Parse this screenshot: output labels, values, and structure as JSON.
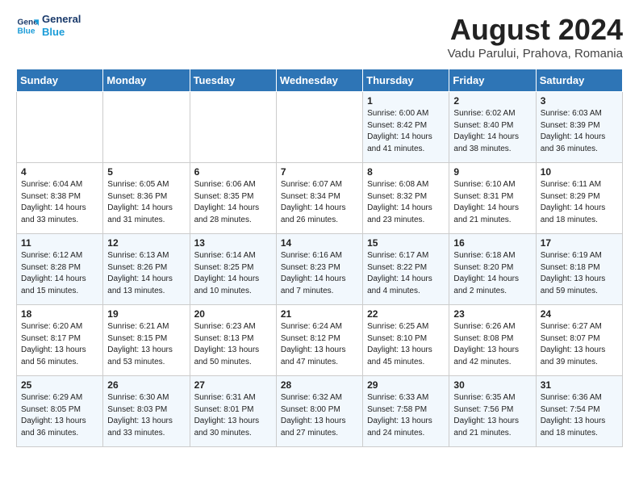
{
  "header": {
    "logo_line1": "General",
    "logo_line2": "Blue",
    "main_title": "August 2024",
    "subtitle": "Vadu Parului, Prahova, Romania"
  },
  "weekdays": [
    "Sunday",
    "Monday",
    "Tuesday",
    "Wednesday",
    "Thursday",
    "Friday",
    "Saturday"
  ],
  "weeks": [
    [
      {
        "day": "",
        "info": ""
      },
      {
        "day": "",
        "info": ""
      },
      {
        "day": "",
        "info": ""
      },
      {
        "day": "",
        "info": ""
      },
      {
        "day": "1",
        "info": "Sunrise: 6:00 AM\nSunset: 8:42 PM\nDaylight: 14 hours\nand 41 minutes."
      },
      {
        "day": "2",
        "info": "Sunrise: 6:02 AM\nSunset: 8:40 PM\nDaylight: 14 hours\nand 38 minutes."
      },
      {
        "day": "3",
        "info": "Sunrise: 6:03 AM\nSunset: 8:39 PM\nDaylight: 14 hours\nand 36 minutes."
      }
    ],
    [
      {
        "day": "4",
        "info": "Sunrise: 6:04 AM\nSunset: 8:38 PM\nDaylight: 14 hours\nand 33 minutes."
      },
      {
        "day": "5",
        "info": "Sunrise: 6:05 AM\nSunset: 8:36 PM\nDaylight: 14 hours\nand 31 minutes."
      },
      {
        "day": "6",
        "info": "Sunrise: 6:06 AM\nSunset: 8:35 PM\nDaylight: 14 hours\nand 28 minutes."
      },
      {
        "day": "7",
        "info": "Sunrise: 6:07 AM\nSunset: 8:34 PM\nDaylight: 14 hours\nand 26 minutes."
      },
      {
        "day": "8",
        "info": "Sunrise: 6:08 AM\nSunset: 8:32 PM\nDaylight: 14 hours\nand 23 minutes."
      },
      {
        "day": "9",
        "info": "Sunrise: 6:10 AM\nSunset: 8:31 PM\nDaylight: 14 hours\nand 21 minutes."
      },
      {
        "day": "10",
        "info": "Sunrise: 6:11 AM\nSunset: 8:29 PM\nDaylight: 14 hours\nand 18 minutes."
      }
    ],
    [
      {
        "day": "11",
        "info": "Sunrise: 6:12 AM\nSunset: 8:28 PM\nDaylight: 14 hours\nand 15 minutes."
      },
      {
        "day": "12",
        "info": "Sunrise: 6:13 AM\nSunset: 8:26 PM\nDaylight: 14 hours\nand 13 minutes."
      },
      {
        "day": "13",
        "info": "Sunrise: 6:14 AM\nSunset: 8:25 PM\nDaylight: 14 hours\nand 10 minutes."
      },
      {
        "day": "14",
        "info": "Sunrise: 6:16 AM\nSunset: 8:23 PM\nDaylight: 14 hours\nand 7 minutes."
      },
      {
        "day": "15",
        "info": "Sunrise: 6:17 AM\nSunset: 8:22 PM\nDaylight: 14 hours\nand 4 minutes."
      },
      {
        "day": "16",
        "info": "Sunrise: 6:18 AM\nSunset: 8:20 PM\nDaylight: 14 hours\nand 2 minutes."
      },
      {
        "day": "17",
        "info": "Sunrise: 6:19 AM\nSunset: 8:18 PM\nDaylight: 13 hours\nand 59 minutes."
      }
    ],
    [
      {
        "day": "18",
        "info": "Sunrise: 6:20 AM\nSunset: 8:17 PM\nDaylight: 13 hours\nand 56 minutes."
      },
      {
        "day": "19",
        "info": "Sunrise: 6:21 AM\nSunset: 8:15 PM\nDaylight: 13 hours\nand 53 minutes."
      },
      {
        "day": "20",
        "info": "Sunrise: 6:23 AM\nSunset: 8:13 PM\nDaylight: 13 hours\nand 50 minutes."
      },
      {
        "day": "21",
        "info": "Sunrise: 6:24 AM\nSunset: 8:12 PM\nDaylight: 13 hours\nand 47 minutes."
      },
      {
        "day": "22",
        "info": "Sunrise: 6:25 AM\nSunset: 8:10 PM\nDaylight: 13 hours\nand 45 minutes."
      },
      {
        "day": "23",
        "info": "Sunrise: 6:26 AM\nSunset: 8:08 PM\nDaylight: 13 hours\nand 42 minutes."
      },
      {
        "day": "24",
        "info": "Sunrise: 6:27 AM\nSunset: 8:07 PM\nDaylight: 13 hours\nand 39 minutes."
      }
    ],
    [
      {
        "day": "25",
        "info": "Sunrise: 6:29 AM\nSunset: 8:05 PM\nDaylight: 13 hours\nand 36 minutes."
      },
      {
        "day": "26",
        "info": "Sunrise: 6:30 AM\nSunset: 8:03 PM\nDaylight: 13 hours\nand 33 minutes."
      },
      {
        "day": "27",
        "info": "Sunrise: 6:31 AM\nSunset: 8:01 PM\nDaylight: 13 hours\nand 30 minutes."
      },
      {
        "day": "28",
        "info": "Sunrise: 6:32 AM\nSunset: 8:00 PM\nDaylight: 13 hours\nand 27 minutes."
      },
      {
        "day": "29",
        "info": "Sunrise: 6:33 AM\nSunset: 7:58 PM\nDaylight: 13 hours\nand 24 minutes."
      },
      {
        "day": "30",
        "info": "Sunrise: 6:35 AM\nSunset: 7:56 PM\nDaylight: 13 hours\nand 21 minutes."
      },
      {
        "day": "31",
        "info": "Sunrise: 6:36 AM\nSunset: 7:54 PM\nDaylight: 13 hours\nand 18 minutes."
      }
    ]
  ]
}
